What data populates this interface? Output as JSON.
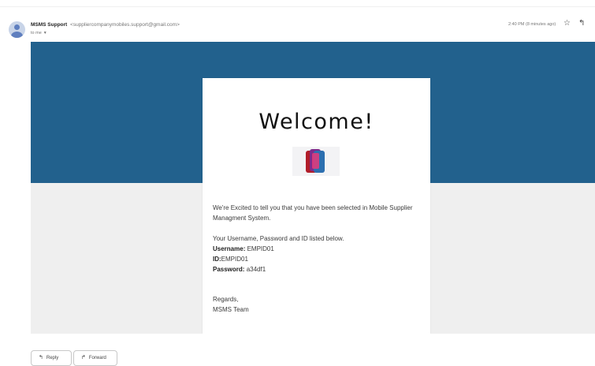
{
  "header": {
    "sender_name": "MSMS Support",
    "sender_email": "<suppliercompanymobiles.support@gmail.com>",
    "to_line": "to me",
    "timestamp": "2:40 PM (8 minutes ago)",
    "icons": {
      "avatar": "avatar-icon",
      "star": "star-icon",
      "reply": "reply-icon",
      "caret": "chevron-down-icon"
    }
  },
  "email": {
    "banner_color": "#22618d",
    "title": "Welcome!",
    "logo": "mobile-phones-logo",
    "intro_text": "We're Excited to tell you that you have been selected in Mobile Supplier Managment System.",
    "credentials_intro": "Your Username, Password and ID listed below.",
    "username_label": "Username:",
    "username_value": "EMPID01",
    "id_label": "ID:",
    "id_value": "EMPID01",
    "password_label": "Password:",
    "password_value": "a34df1",
    "regards_line": "Regards,",
    "team_name": "MSMS Team"
  },
  "actions": {
    "reply_label": "Reply",
    "forward_label": "Forward"
  }
}
